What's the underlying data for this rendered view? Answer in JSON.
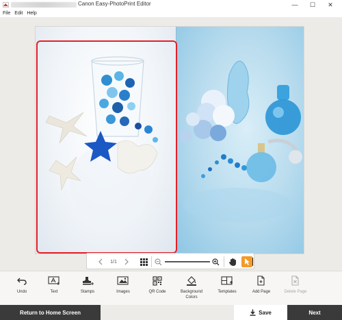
{
  "window": {
    "title": "Canon Easy-PhotoPrint Editor",
    "minimize_glyph": "—",
    "maximize_glyph": "☐",
    "close_glyph": "✕"
  },
  "menu": [
    "File",
    "Edit",
    "Help"
  ],
  "zoom_bar": {
    "page_indicator": "1/1",
    "prev_icon": "chevron-left-icon",
    "next_icon": "chevron-right-icon",
    "zoom_level": 0.02
  },
  "toolbar": {
    "items": [
      {
        "label": "Undo",
        "icon": "undo-icon",
        "enabled": true
      },
      {
        "label": "Text",
        "icon": "text-icon",
        "enabled": true
      },
      {
        "label": "Stamps",
        "icon": "stamp-icon",
        "enabled": true
      },
      {
        "label": "Images",
        "icon": "images-icon",
        "enabled": true
      },
      {
        "label": "QR Code",
        "icon": "qr-code-icon",
        "enabled": true
      },
      {
        "label": "Background\nColors",
        "icon": "fill-bucket-icon",
        "enabled": true
      },
      {
        "label": "Templates",
        "icon": "templates-icon",
        "enabled": true
      },
      {
        "label": "Add Page",
        "icon": "add-page-icon",
        "enabled": true
      },
      {
        "label": "Delete Page",
        "icon": "delete-page-icon",
        "enabled": false
      }
    ]
  },
  "footer": {
    "home_label": "Return to Home Screen",
    "save_label": "Save",
    "next_label": "Next"
  },
  "colors": {
    "selection": "#e41f26",
    "accent": "#f39a2a",
    "footer_bg": "#3a3a3a"
  }
}
